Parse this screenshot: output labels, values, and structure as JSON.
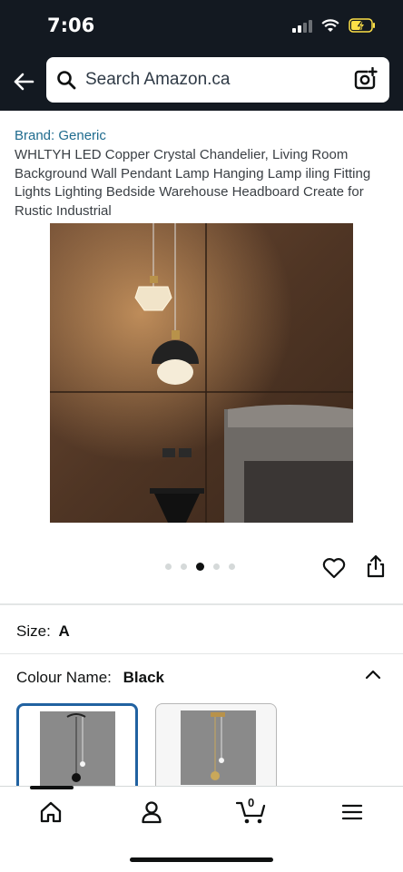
{
  "status": {
    "time": "7:06",
    "icons": [
      "signal-icon",
      "wifi-icon",
      "battery-charging-icon"
    ]
  },
  "search": {
    "placeholder": "Search Amazon.ca"
  },
  "product": {
    "brand": "Brand: Generic",
    "title": "WHLTYH LED Copper Crystal Chandelier, Living Room Background Wall Pendant Lamp Hanging Lamp iling Fitting Lights Lighting Bedside Warehouse Headboard Create for Rustic Industrial",
    "image_count": 5,
    "selected_image_index": 2
  },
  "size": {
    "label": "Size:",
    "value": "A"
  },
  "colour": {
    "label": "Colour Name:",
    "value": "Black",
    "options": [
      "black-option",
      "gold-option"
    ]
  },
  "bottom_nav": {
    "items": [
      "home-icon",
      "account-icon",
      "cart-icon",
      "menu-icon"
    ],
    "cart_count": "0"
  },
  "colors": {
    "header_bg": "#131921",
    "link": "#1f6b8e",
    "selected_border": "#2162a1"
  }
}
